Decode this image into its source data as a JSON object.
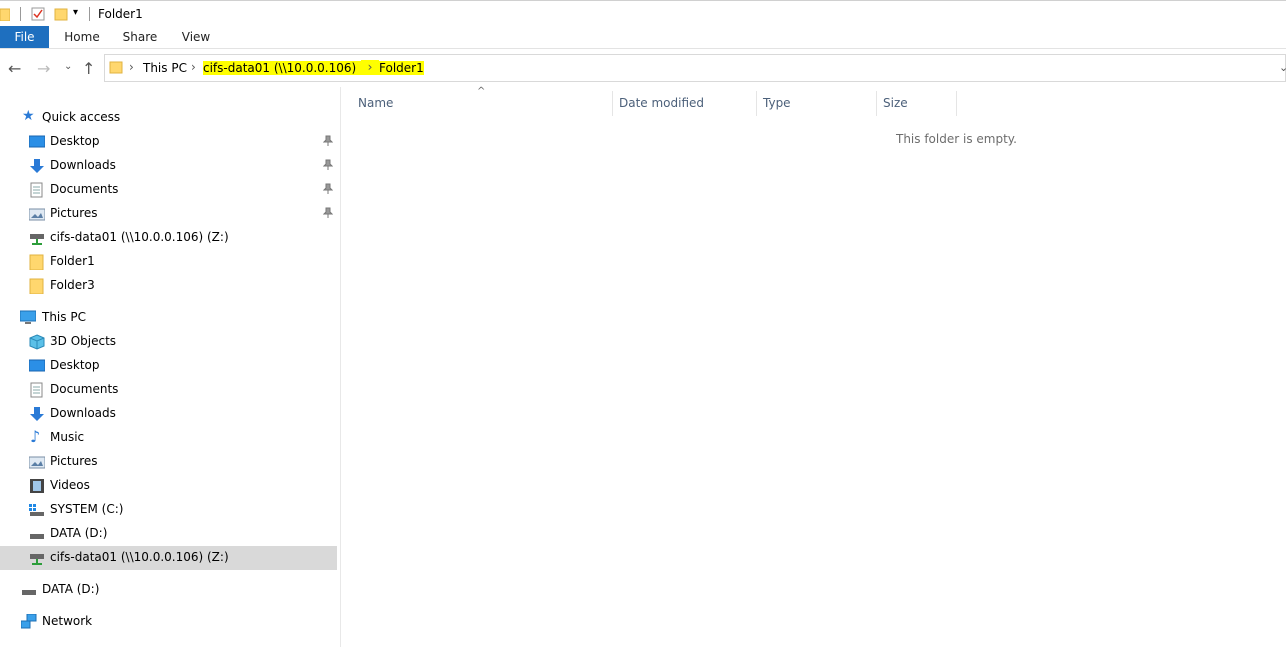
{
  "window": {
    "title": "Folder1"
  },
  "ribbon": {
    "tabs": [
      "File",
      "Home",
      "Share",
      "View"
    ]
  },
  "address": {
    "crumbs": [
      "This PC",
      "cifs-data01 (\\\\10.0.0.106) (Z:)",
      "Folder1"
    ]
  },
  "nav": {
    "quick_access": "Quick access",
    "quick_items": [
      "Desktop",
      "Downloads",
      "Documents",
      "Pictures",
      "cifs-data01 (\\\\10.0.0.106) (Z:)",
      "Folder1",
      "Folder3"
    ],
    "this_pc": "This PC",
    "pc_items": [
      "3D Objects",
      "Desktop",
      "Documents",
      "Downloads",
      "Music",
      "Pictures",
      "Videos",
      "SYSTEM (C:)",
      "DATA (D:)",
      "cifs-data01 (\\\\10.0.0.106) (Z:)"
    ],
    "data_drive": "DATA (D:)",
    "network": "Network"
  },
  "columns": [
    "Name",
    "Date modified",
    "Type",
    "Size"
  ],
  "empty_message": "This folder is empty.",
  "colors": {
    "accent": "#1e6fbf",
    "highlight": "#ffff00",
    "selected": "#d9d9d9"
  }
}
